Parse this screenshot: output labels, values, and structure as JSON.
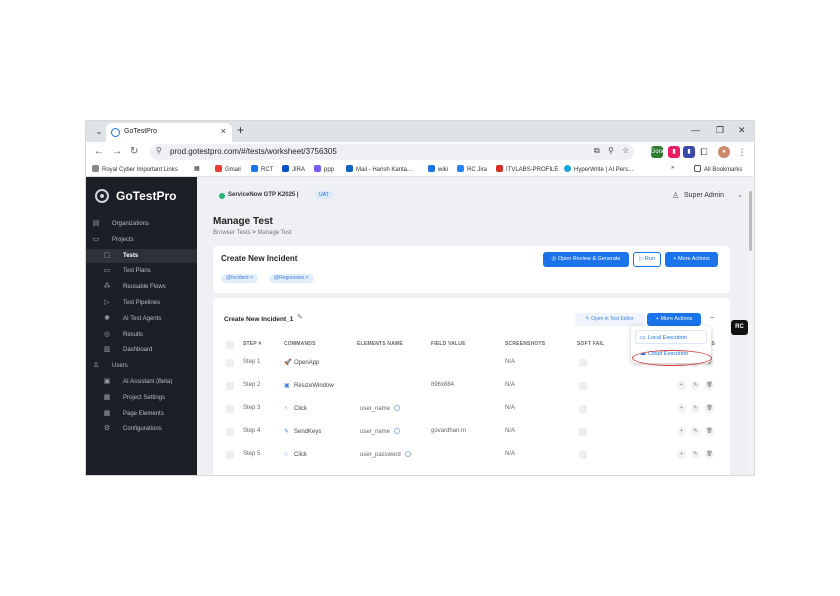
{
  "browser": {
    "tab_title": "GoTestPro",
    "url": "prod.gotestpro.com/#/tests/worksheet/3756305",
    "bookmarks": [
      {
        "label": "Royal Cyber Important Links",
        "color": "#666666"
      },
      {
        "label": "Gmail",
        "color": "#e44134"
      },
      {
        "label": "RCT",
        "color": "#1a73e8"
      },
      {
        "label": "JIRA",
        "color": "#0052cc"
      },
      {
        "label": "ppp",
        "color": "#7a5af8"
      },
      {
        "label": "Mail - Harish Kanta...",
        "color": "#0a66c2"
      },
      {
        "label": "wiki",
        "color": "#1a73e8"
      },
      {
        "label": "RC Jira",
        "color": "#2684ff"
      },
      {
        "label": "ITVLABS-PROFILE",
        "color": "#d93025"
      },
      {
        "label": "HyperWrite | AI Pers...",
        "color": "#12a3e0"
      }
    ],
    "all_bookmarks": "All Bookmarks",
    "more_bookmarks": "»",
    "ext_done": "Done"
  },
  "sidebar": {
    "logo": "GoTestPro",
    "items": [
      {
        "label": "Organizations",
        "icon": "▤",
        "indent": 0,
        "active": false
      },
      {
        "label": "Projects",
        "icon": "▭",
        "indent": 0,
        "active": false
      },
      {
        "label": "Tests",
        "icon": "▢",
        "indent": 1,
        "active": true
      },
      {
        "label": "Test Plans",
        "icon": "▭",
        "indent": 1,
        "active": false
      },
      {
        "label": "Reusable Flows",
        "icon": "⁂",
        "indent": 1,
        "active": false
      },
      {
        "label": "Test Pipelines",
        "icon": "▷",
        "indent": 1,
        "active": false
      },
      {
        "label": "AI Test Agents",
        "icon": "✺",
        "indent": 1,
        "active": false
      },
      {
        "label": "Results",
        "icon": "◎",
        "indent": 1,
        "active": false
      },
      {
        "label": "Dashboard",
        "icon": "▥",
        "indent": 1,
        "active": false
      },
      {
        "label": "Users",
        "icon": "♙",
        "indent": 0,
        "active": false
      },
      {
        "label": "AI Assistant (Beta)",
        "icon": "▣",
        "indent": 1,
        "active": false
      },
      {
        "label": "Project Settings",
        "icon": "▦",
        "indent": 1,
        "active": false
      },
      {
        "label": "Page Elements",
        "icon": "▦",
        "indent": 1,
        "active": false
      },
      {
        "label": "Configurations",
        "icon": "⚙",
        "indent": 1,
        "active": false
      }
    ]
  },
  "header": {
    "project": "ServiceNow GTP K2025  |",
    "env_badge": "UAT",
    "user": "Super Admin"
  },
  "page": {
    "title": "Manage Test",
    "breadcrumb_parent": "Browser Tests",
    "breadcrumb_sep": ">",
    "breadcrumb_current": "Manage Test"
  },
  "test_card": {
    "title": "Create New Incident",
    "tags": [
      "@Incident ×",
      "@Regression ×"
    ],
    "open_review_label": "Open Review & Generate",
    "run_label": "Run",
    "more_actions_label": "More Actions"
  },
  "run_menu": {
    "local_label": "Local Execution",
    "cloud_label": "Cloud Execution"
  },
  "steps_card": {
    "title": "Create New Incident_1",
    "open_editor_label": "Open in Test Editor",
    "more_actions_label": "More Actions",
    "columns": [
      "STEP #",
      "COMMANDS",
      "ELEMENTS NAME",
      "FIELD VALUE",
      "SCREENSHOTS",
      "SOFT FAIL",
      "ACTIONS"
    ],
    "rows": [
      {
        "step": "Step 1",
        "icon": "🚀",
        "command": "OpenApp",
        "element": "",
        "value": "",
        "screenshot": "N/A",
        "info": false
      },
      {
        "step": "Step 2",
        "icon": "▣",
        "command": "ResizeWindow",
        "element": "",
        "value": "896x884",
        "screenshot": "N/A",
        "info": false
      },
      {
        "step": "Step 3",
        "icon": "☝",
        "command": "Click",
        "element": "user_name",
        "value": "",
        "screenshot": "N/A",
        "info": true
      },
      {
        "step": "Step 4",
        "icon": "✎",
        "command": "SendKeys",
        "element": "user_name",
        "value": "govardhan.m",
        "screenshot": "N/A",
        "info": true
      },
      {
        "step": "Step 5",
        "icon": "☝",
        "command": "Click",
        "element": "user_password",
        "value": "",
        "screenshot": "N/A",
        "info": true
      }
    ]
  },
  "overlay": {
    "rc_badge": "RC"
  },
  "colors": {
    "accent": "#1a73e8",
    "sidebar_bg": "#1c1f26",
    "status_green": "#22b573",
    "highlight_red": "#d23c3c"
  }
}
